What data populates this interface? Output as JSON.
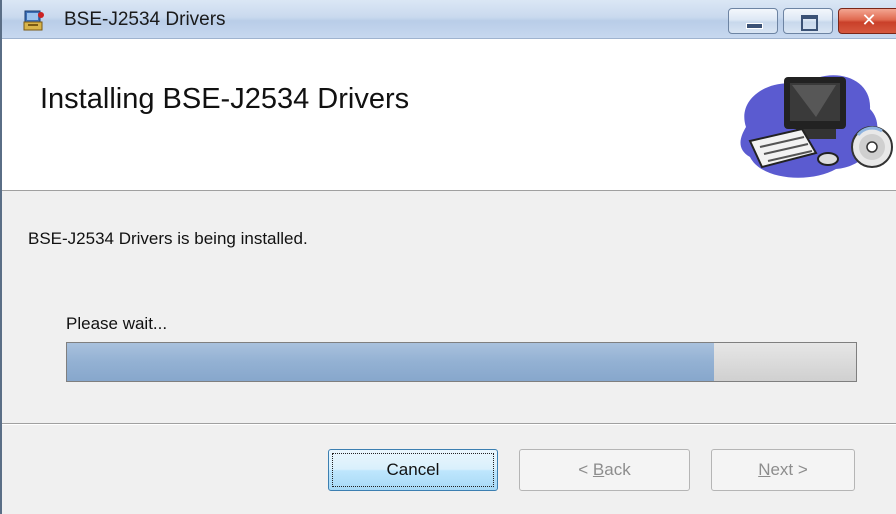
{
  "window": {
    "title": "BSE-J2534 Drivers"
  },
  "banner": {
    "title": "Installing BSE-J2534 Drivers",
    "art_icon": "computer-with-cd-icon"
  },
  "body": {
    "status_text": "BSE-J2534 Drivers is being installed.",
    "wait_label": "Please wait...",
    "progress_percent": 82
  },
  "buttons": {
    "cancel": "Cancel",
    "back_prefix": "< ",
    "back_mnemonic": "B",
    "back_rest": "ack",
    "next_mnemonic": "N",
    "next_rest": "ext >"
  },
  "colors": {
    "progress_fill": "#93b1d3",
    "close_button": "#d6583e"
  }
}
